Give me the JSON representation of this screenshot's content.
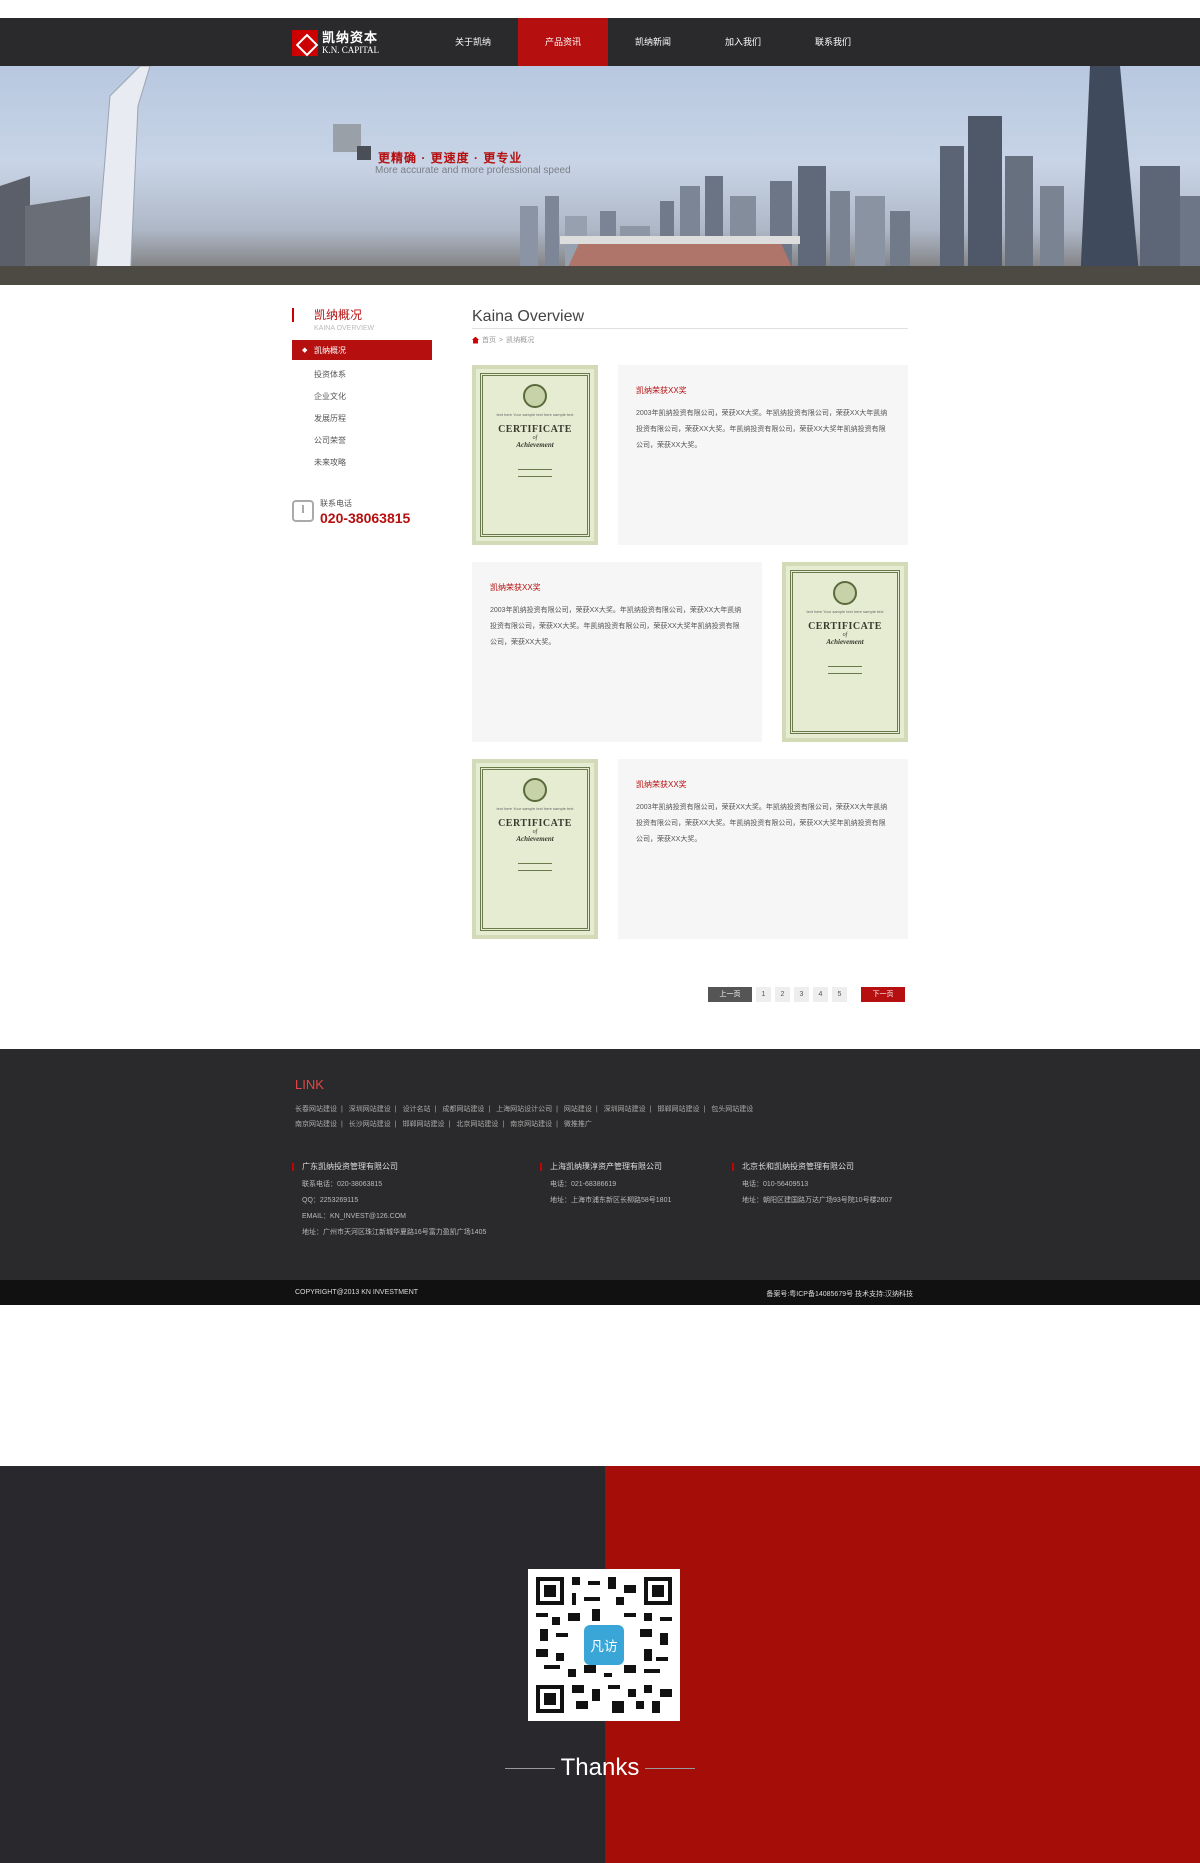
{
  "header": {
    "logo_cn": "凯纳资本",
    "logo_en": "K.N. CAPITAL",
    "nav": [
      "关于凯纳",
      "产品资讯",
      "凯纳新闻",
      "加入我们",
      "联系我们"
    ]
  },
  "banner": {
    "slogan_cn": "更精确 · 更速度 · 更专业",
    "slogan_en": "More accurate and more professional speed"
  },
  "sidebar": {
    "title": "凯纳概况",
    "subtitle": "KAINA OVERVIEW",
    "items": [
      "凯纳概况",
      "投资体系",
      "企业文化",
      "发展历程",
      "公司荣誉",
      "未来攻略"
    ],
    "contact_label": "联系电话",
    "contact_number": "020-38063815"
  },
  "main": {
    "title": "Kaina Overview",
    "breadcrumb_home": "首页",
    "breadcrumb_sep": ">",
    "breadcrumb_current": "凯纳概况",
    "awards": [
      {
        "title": "凯纳荣获XX奖",
        "desc": "2003年凯纳投资有限公司，荣获XX大奖。年凯纳投资有限公司，荣获XX大年凯纳投资有限公司，荣获XX大奖。年凯纳投资有限公司，荣获XX大奖年凯纳投资有限公司，荣获XX大奖。",
        "cert": {
          "small": "text here\nYour sample text here sample text",
          "title": "CERTIFICATE",
          "of": "of",
          "ach": "Achievement"
        }
      },
      {
        "title": "凯纳荣获XX奖",
        "desc": "2003年凯纳投资有限公司，荣获XX大奖。年凯纳投资有限公司，荣获XX大年凯纳投资有限公司，荣获XX大奖。年凯纳投资有限公司，荣获XX大奖年凯纳投资有限公司，荣获XX大奖。",
        "cert": {
          "small": "text here\nYour sample text here sample text",
          "title": "CERTIFICATE",
          "of": "of",
          "ach": "Achievement"
        }
      },
      {
        "title": "凯纳荣获XX奖",
        "desc": "2003年凯纳投资有限公司，荣获XX大奖。年凯纳投资有限公司，荣获XX大年凯纳投资有限公司，荣获XX大奖。年凯纳投资有限公司，荣获XX大奖年凯纳投资有限公司，荣获XX大奖。",
        "cert": {
          "small": "text here\nYour sample text here sample text",
          "title": "CERTIFICATE",
          "of": "of",
          "ach": "Achievement"
        }
      }
    ]
  },
  "pagination": {
    "prev": "上一页",
    "pages": [
      "1",
      "2",
      "3",
      "4",
      "5"
    ],
    "next": "下一页"
  },
  "footer": {
    "link_title": "LINK",
    "links_row1": [
      "长春网站建设",
      "深圳网站建设",
      "设计名站",
      "成都网站建设",
      "上海网站设计公司",
      "网站建设",
      "深圳网站建设",
      "邯郸网站建设",
      "包头网站建设"
    ],
    "links_row2": [
      "南京网站建设",
      "长沙网站建设",
      "邯郸网站建设",
      "北京网站建设",
      "南京网站建设",
      "微推推广"
    ],
    "offices": [
      {
        "name": "广东凯纳投资管理有限公司",
        "lines": [
          "联系电话：020-38063815",
          "QQ：2253269115",
          "EMAIL：KN_INVEST@126.COM",
          "地址：广州市天河区珠江新城华夏路16号富力盈凯广场1405"
        ]
      },
      {
        "name": "上海凯纳璞淳资产管理有限公司",
        "lines": [
          "电话：021-68386619",
          "地址：上海市浦东新区长柳路58号1801"
        ]
      },
      {
        "name": "北京长和凯纳投资管理有限公司",
        "lines": [
          "电话：010-56409513",
          "地址：朝阳区建国路万达广场93号院10号楼2607"
        ]
      }
    ],
    "copyright": "COPYRIGHT@2013 KN INVESTMENT",
    "icp": "备案号:粤ICP备14085679号 技术支持:汉纳科技"
  },
  "thanks": {
    "text": "Thanks",
    "qr_center": "凡访"
  },
  "colors": {
    "brand_red": "#b50f0f",
    "header_dark": "#2a2a2c",
    "thanks_red": "#a50e08"
  }
}
